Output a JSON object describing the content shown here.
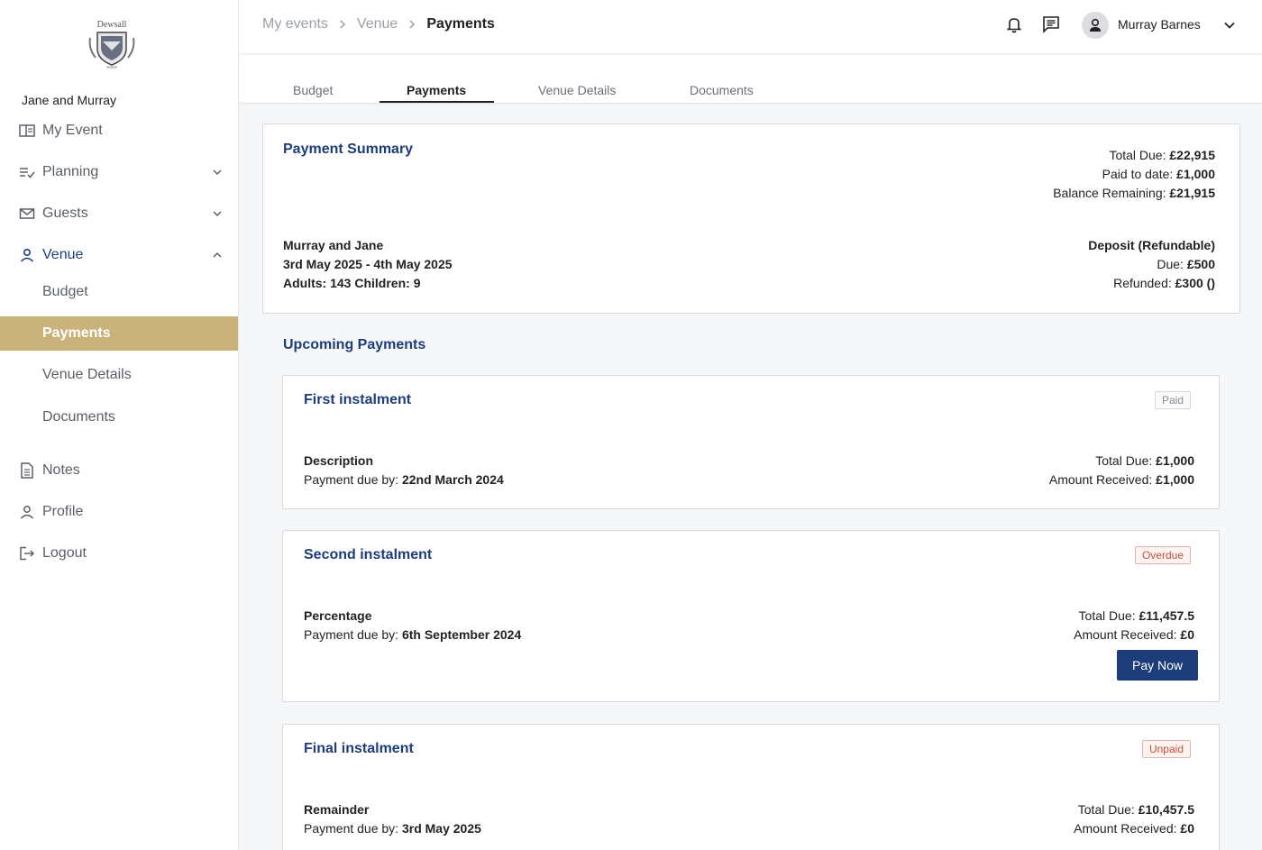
{
  "sidebar": {
    "logo_text": "Dewsall",
    "event_name": "Jane and Murray",
    "items": [
      {
        "label": "My Event"
      },
      {
        "label": "Planning"
      },
      {
        "label": "Guests"
      },
      {
        "label": "Venue"
      },
      {
        "label": "Budget"
      },
      {
        "label": "Payments"
      },
      {
        "label": "Venue Details"
      },
      {
        "label": "Documents"
      },
      {
        "label": "Notes"
      },
      {
        "label": "Profile"
      },
      {
        "label": "Logout"
      }
    ]
  },
  "header": {
    "breadcrumbs": [
      "My events",
      "Venue",
      "Payments"
    ],
    "user_name": "Murray Barnes"
  },
  "tabs": [
    {
      "label": "Budget"
    },
    {
      "label": "Payments"
    },
    {
      "label": "Venue Details"
    },
    {
      "label": "Documents"
    }
  ],
  "summary": {
    "title": "Payment Summary",
    "total_due_label": "Total Due:",
    "total_due": "£22,915",
    "paid_label": "Paid to date:",
    "paid": "£1,000",
    "balance_label": "Balance Remaining:",
    "balance": "£21,915",
    "couple": "Murray and Jane",
    "dates": "3rd May 2025 - 4th May 2025",
    "adults_label": "Adults:",
    "adults": "143",
    "children_label": "Children:",
    "children": "9",
    "deposit_title": "Deposit (Refundable)",
    "deposit_due_label": "Due:",
    "deposit_due": "£500",
    "refunded_label": "Refunded:",
    "refunded": "£300 ()"
  },
  "upcoming_title": "Upcoming Payments",
  "payments": [
    {
      "title": "First instalment",
      "status": "Paid",
      "type": "Description",
      "due_label": "Payment due by:",
      "due_date": "22nd March 2024",
      "total_label": "Total Due:",
      "total": "£1,000",
      "received_label": "Amount Received:",
      "received": "£1,000"
    },
    {
      "title": "Second instalment",
      "status": "Overdue",
      "type": "Percentage",
      "due_label": "Payment due by:",
      "due_date": "6th September 2024",
      "total_label": "Total Due:",
      "total": "£11,457.5",
      "received_label": "Amount Received:",
      "received": "£0",
      "button": "Pay Now"
    },
    {
      "title": "Final instalment",
      "status": "Unpaid",
      "type": "Remainder",
      "due_label": "Payment due by:",
      "due_date": "3rd May 2025",
      "total_label": "Total Due:",
      "total": "£10,457.5",
      "received_label": "Amount Received:",
      "received": "£0"
    }
  ],
  "colors": {
    "accent": "#1d3d7a",
    "selected_nav": "#c9b27c",
    "overdue": "#c0513c"
  }
}
